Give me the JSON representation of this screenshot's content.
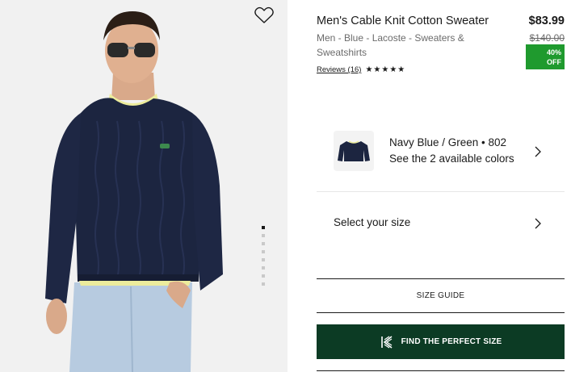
{
  "product": {
    "title": "Men's Cable Knit Cotton Sweater",
    "price": "$83.99",
    "original_price": "$140.00",
    "discount_badge": "40% OFF",
    "discount_line1": "40%",
    "discount_line2": "OFF",
    "breadcrumb_line1": "Men - Blue - Lacoste - Sweaters &",
    "breadcrumb_line2": "Sweatshirts",
    "reviews_label": "Reviews (16)",
    "rating_stars": 5,
    "stars_text": "★★★★★",
    "image_alt": "Model wearing navy blue cable knit sweater"
  },
  "gallery": {
    "image_count": 8,
    "active_index": 0,
    "wishlist_icon": "heart-outline-icon"
  },
  "color_selector": {
    "line1": "Navy Blue / Green • 802",
    "line2": "See the 2 available colors",
    "icon": "chevron-right-icon"
  },
  "size_selector": {
    "label": "Select your size",
    "icon": "chevron-right-icon"
  },
  "size_guide": {
    "label": "SIZE GUIDE"
  },
  "fit_finder": {
    "label": "FIND THE PERFECT SIZE",
    "icon": "kiwi-sizing-icon"
  },
  "colors": {
    "accent_green": "#0c3b24",
    "discount_green": "#1f9a2e",
    "image_background": "#f1f1f1",
    "sweater_navy": "#1c2540"
  }
}
